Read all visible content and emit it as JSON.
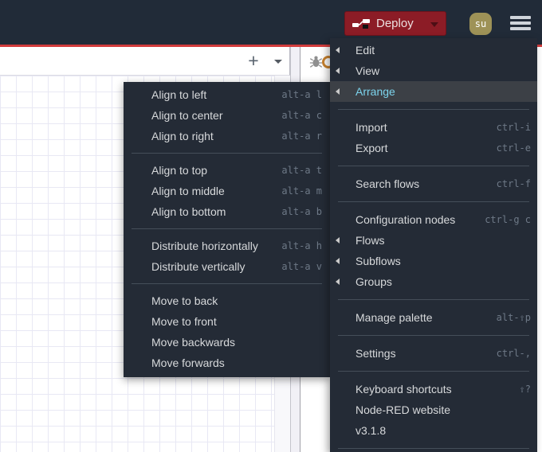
{
  "header": {
    "deploy_label": "Deploy",
    "avatar_initials": "su"
  },
  "toolbar": {
    "add_flow_label": "+"
  },
  "menu": {
    "items": [
      {
        "label": "Edit",
        "has_submenu": true
      },
      {
        "label": "View",
        "has_submenu": true
      },
      {
        "label": "Arrange",
        "has_submenu": true,
        "active": true
      },
      {
        "label": "Import",
        "shortcut": "ctrl-i"
      },
      {
        "label": "Export",
        "shortcut": "ctrl-e"
      },
      {
        "label": "Search flows",
        "shortcut": "ctrl-f"
      },
      {
        "label": "Configuration nodes",
        "shortcut": "ctrl-g c"
      },
      {
        "label": "Flows",
        "has_submenu": true
      },
      {
        "label": "Subflows",
        "has_submenu": true
      },
      {
        "label": "Groups",
        "has_submenu": true
      },
      {
        "label": "Manage palette",
        "shortcut": "alt-⇧p"
      },
      {
        "label": "Settings",
        "shortcut": "ctrl-,"
      },
      {
        "label": "Keyboard shortcuts",
        "shortcut": "⇧?"
      },
      {
        "label": "Node-RED website"
      },
      {
        "label": "v3.1.8"
      }
    ]
  },
  "submenu": {
    "parent": "Arrange",
    "items": [
      {
        "label": "Align to left",
        "shortcut": "alt-a l"
      },
      {
        "label": "Align to center",
        "shortcut": "alt-a c"
      },
      {
        "label": "Align to right",
        "shortcut": "alt-a r"
      },
      {
        "label": "Align to top",
        "shortcut": "alt-a t"
      },
      {
        "label": "Align to middle",
        "shortcut": "alt-a m"
      },
      {
        "label": "Align to bottom",
        "shortcut": "alt-a b"
      },
      {
        "label": "Distribute horizontally",
        "shortcut": "alt-a h"
      },
      {
        "label": "Distribute vertically",
        "shortcut": "alt-a v"
      },
      {
        "label": "Move to back"
      },
      {
        "label": "Move to front"
      },
      {
        "label": "Move backwards"
      },
      {
        "label": "Move forwards"
      }
    ]
  },
  "icons": {
    "deploy": "deploy-node-wire-icon",
    "deploy_caret": "caret-down-icon",
    "user": "avatar",
    "main_menu": "hamburger-icon",
    "add_flow": "plus-icon",
    "tab_list": "caret-down-icon",
    "debug": "bug-icon",
    "submenu_indicator": "chevron-left-icon"
  },
  "colors": {
    "header_bg": "#212b38",
    "accent_red": "#d23c3c",
    "deploy_red": "#8c1c26",
    "avatar_olive": "#9e9257",
    "menu_bg": "#242b36",
    "active_item_bg": "#3c4046",
    "active_item_text": "#7cd3ec",
    "shortcut_text": "#6e7987",
    "grid_line": "#e8e8f4"
  }
}
